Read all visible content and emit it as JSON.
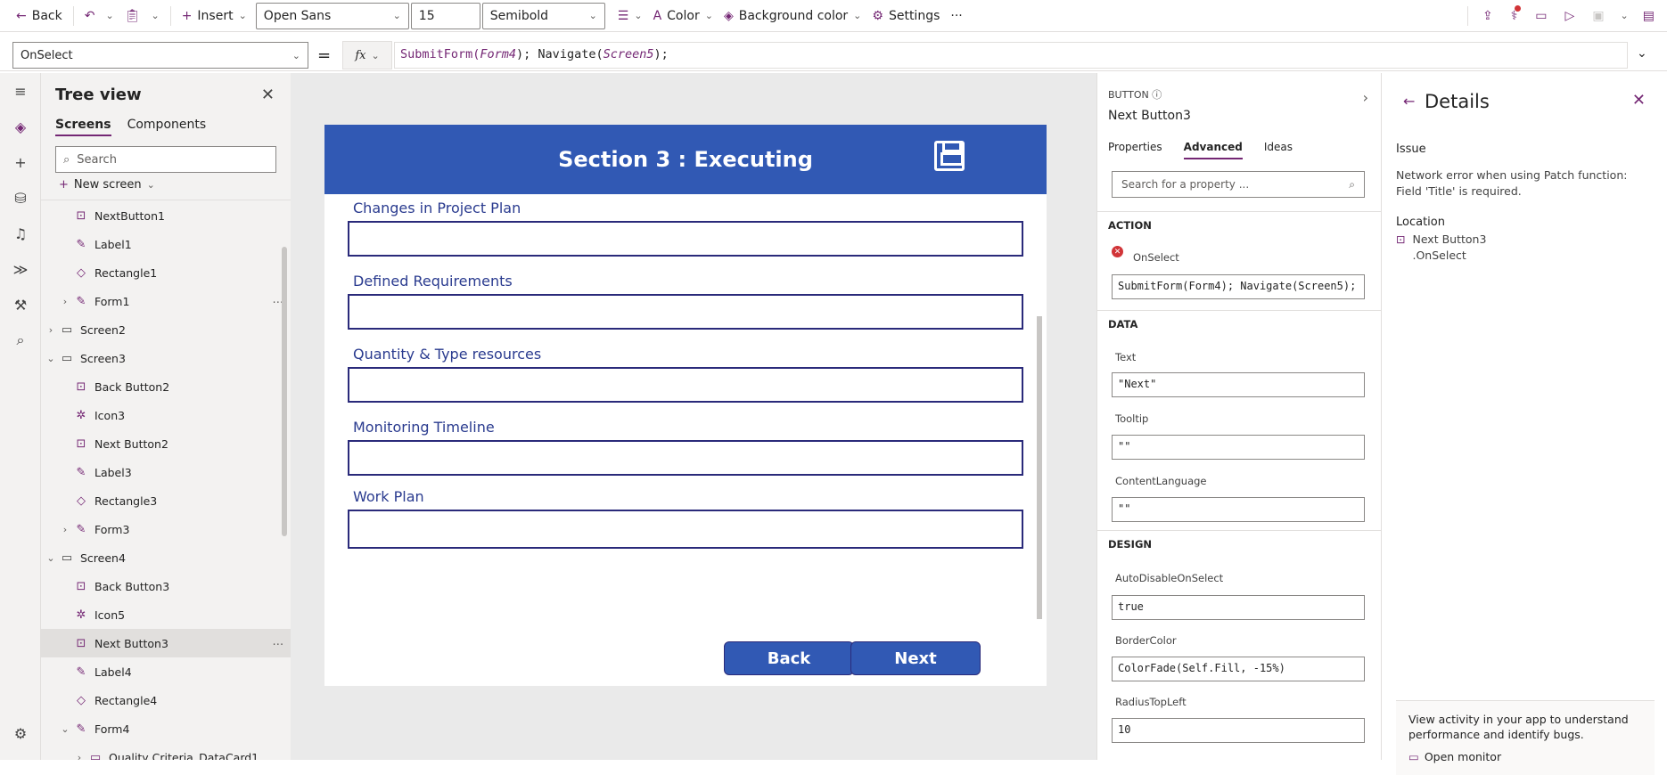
{
  "toolbar": {
    "back": "Back",
    "insert": "Insert",
    "font": "Open Sans",
    "font_size": "15",
    "font_weight": "Semibold",
    "color": "Color",
    "background_color": "Background color",
    "settings": "Settings",
    "more": "···"
  },
  "formula": {
    "property": "OnSelect",
    "equals": "=",
    "fx": "fx",
    "code_a": "SubmitForm(",
    "code_b": "Form4",
    "code_c": "); Navigate(",
    "code_d": "Screen5",
    "code_e": ");"
  },
  "tree": {
    "title": "Tree view",
    "tab_screens": "Screens",
    "tab_components": "Components",
    "search_placeholder": "Search",
    "new_screen": "New screen",
    "nodes": [
      {
        "label": "NextButton1",
        "icon": "button-icon",
        "level": 2,
        "expand": ""
      },
      {
        "label": "Label1",
        "icon": "label-icon",
        "level": 2,
        "expand": ""
      },
      {
        "label": "Rectangle1",
        "icon": "shape-icon",
        "level": 2,
        "expand": ""
      },
      {
        "label": "Form1",
        "icon": "form-icon",
        "level": 2,
        "expand": ">"
      },
      {
        "label": "Screen2",
        "icon": "screen-icon",
        "level": 1,
        "expand": ">"
      },
      {
        "label": "Screen3",
        "icon": "screen-icon",
        "level": 1,
        "expand": "v"
      },
      {
        "label": "Back Button2",
        "icon": "button-icon",
        "level": 2,
        "expand": ""
      },
      {
        "label": "Icon3",
        "icon": "icon-icon",
        "level": 2,
        "expand": ""
      },
      {
        "label": "Next Button2",
        "icon": "button-icon",
        "level": 2,
        "expand": ""
      },
      {
        "label": "Label3",
        "icon": "label-icon",
        "level": 2,
        "expand": ""
      },
      {
        "label": "Rectangle3",
        "icon": "shape-icon",
        "level": 2,
        "expand": ""
      },
      {
        "label": "Form3",
        "icon": "form-icon",
        "level": 2,
        "expand": ">"
      },
      {
        "label": "Screen4",
        "icon": "screen-icon",
        "level": 1,
        "expand": "v"
      },
      {
        "label": "Back Button3",
        "icon": "button-icon",
        "level": 2,
        "expand": ""
      },
      {
        "label": "Icon5",
        "icon": "icon-icon",
        "level": 2,
        "expand": ""
      },
      {
        "label": "Next Button3",
        "icon": "button-icon",
        "level": 2,
        "expand": "",
        "selected": true
      },
      {
        "label": "Label4",
        "icon": "label-icon",
        "level": 2,
        "expand": ""
      },
      {
        "label": "Rectangle4",
        "icon": "shape-icon",
        "level": 2,
        "expand": ""
      },
      {
        "label": "Form4",
        "icon": "form-icon",
        "level": 2,
        "expand": "v"
      },
      {
        "label": "Quality Criteria_DataCard1",
        "icon": "card-icon",
        "level": 3,
        "expand": ">"
      }
    ]
  },
  "screen": {
    "title": "Section 3 : Executing",
    "fields": [
      "Changes in Project Plan",
      "Defined Requirements",
      "Quantity & Type resources",
      "Monitoring Timeline",
      "Work Plan"
    ],
    "back_button": "Back",
    "next_button": "Next"
  },
  "props": {
    "kind": "BUTTON",
    "name": "Next Button3",
    "tab_properties": "Properties",
    "tab_advanced": "Advanced",
    "tab_ideas": "Ideas",
    "search_placeholder": "Search for a property ...",
    "section_action": "ACTION",
    "onselect_label": "OnSelect",
    "onselect_value": "SubmitForm(Form4); Navigate(Screen5);",
    "section_data": "DATA",
    "text_label": "Text",
    "text_value": "\"Next\"",
    "tooltip_label": "Tooltip",
    "tooltip_value": "\"\"",
    "contentlang_label": "ContentLanguage",
    "contentlang_value": "\"\"",
    "section_design": "DESIGN",
    "autodisable_label": "AutoDisableOnSelect",
    "autodisable_value": "true",
    "bordercolor_label": "BorderColor",
    "bordercolor_value": "ColorFade(Self.Fill, -15%)",
    "radius_label": "RadiusTopLeft",
    "radius_value": "10"
  },
  "details": {
    "title": "Details",
    "issue_heading": "Issue",
    "issue_text": "Network error when using Patch function: Field 'Title' is required.",
    "location_heading": "Location",
    "location_line1": "Next Button3",
    "location_line2": ".OnSelect",
    "monitor_text": "View activity in your app to understand performance and identify bugs.",
    "monitor_link": "Open monitor"
  },
  "colors": {
    "accent": "#742774",
    "header_blue": "#3159b4",
    "error": "#d13438"
  }
}
